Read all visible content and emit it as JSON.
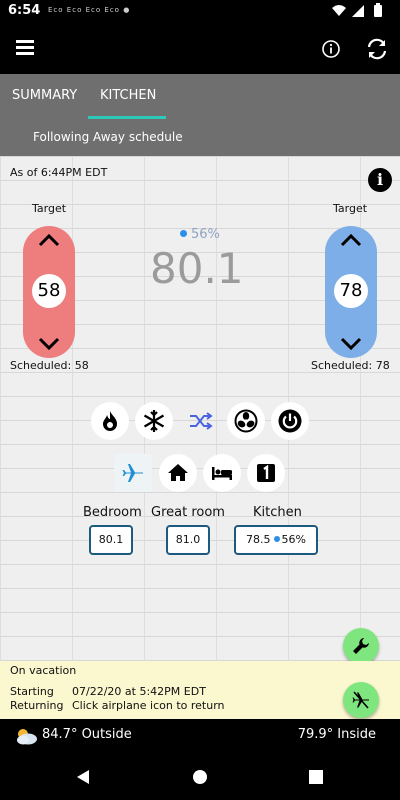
{
  "status_bar": {
    "time": "6:54",
    "notifications": [
      "Eco",
      "Eco",
      "Eco",
      "Eco"
    ]
  },
  "app_bar": {
    "menu_icon": "menu-icon",
    "info_icon": "info-icon",
    "refresh_icon": "refresh-icon"
  },
  "tabs": [
    {
      "label": "SUMMARY"
    },
    {
      "label": "KITCHEN",
      "active": true
    }
  ],
  "schedule_text": "Following Away schedule",
  "as_of": "As of 6:44PM EDT",
  "heat": {
    "target_label": "Target",
    "value": "58",
    "scheduled": "Scheduled: 58",
    "color": "#ee7d7d"
  },
  "cool": {
    "target_label": "Target",
    "value": "78",
    "scheduled": "Scheduled: 78",
    "color": "#7eaee8"
  },
  "current": {
    "humidity": "56%",
    "temperature": "80.1"
  },
  "modes": [
    "flame-icon",
    "snowflake-icon",
    "shuffle-icon",
    "fan-icon",
    "power-icon"
  ],
  "presets": [
    "airplane-icon",
    "home-icon",
    "bed-icon",
    "number-one-icon"
  ],
  "zones": [
    {
      "name": "Bedroom",
      "value": "80.1"
    },
    {
      "name": "Great room",
      "value": "81.0"
    },
    {
      "name": "Kitchen",
      "value": "78.5",
      "humidity": "56%"
    }
  ],
  "vacation": {
    "title": "On vacation",
    "starting_label": "Starting",
    "starting_value": "07/22/20 at 5:42PM EDT",
    "returning_label": "Returning",
    "returning_value": "Click airplane icon to return"
  },
  "weather": {
    "outside": "84.7° Outside",
    "inside": "79.9° Inside"
  },
  "accent_color": "#2ec8b8",
  "fab_color": "#7fe67f"
}
